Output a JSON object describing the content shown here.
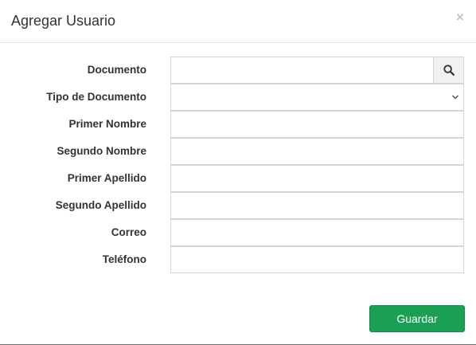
{
  "modal": {
    "title": "Agregar Usuario",
    "close_symbol": "×"
  },
  "form": {
    "fields": [
      {
        "label": "Documento",
        "type": "text-with-search",
        "value": "",
        "placeholder": ""
      },
      {
        "label": "Tipo de Documento",
        "type": "select",
        "value": ""
      },
      {
        "label": "Primer Nombre",
        "type": "text",
        "value": "",
        "placeholder": ""
      },
      {
        "label": "Segundo Nombre",
        "type": "text",
        "value": "",
        "placeholder": ""
      },
      {
        "label": "Primer Apellido",
        "type": "text",
        "value": "",
        "placeholder": ""
      },
      {
        "label": "Segundo Apellido",
        "type": "text",
        "value": "",
        "placeholder": ""
      },
      {
        "label": "Correo",
        "type": "text",
        "value": "",
        "placeholder": ""
      },
      {
        "label": "Teléfono",
        "type": "text",
        "value": "",
        "placeholder": ""
      }
    ]
  },
  "footer": {
    "save_label": "Guardar"
  },
  "icons": {
    "search": "search-icon",
    "close": "close-icon",
    "chevron": "chevron-down-icon"
  },
  "colors": {
    "primary_action": "#1aa055",
    "border": "#d2d6dc",
    "addon_background": "#f1f1f1"
  }
}
